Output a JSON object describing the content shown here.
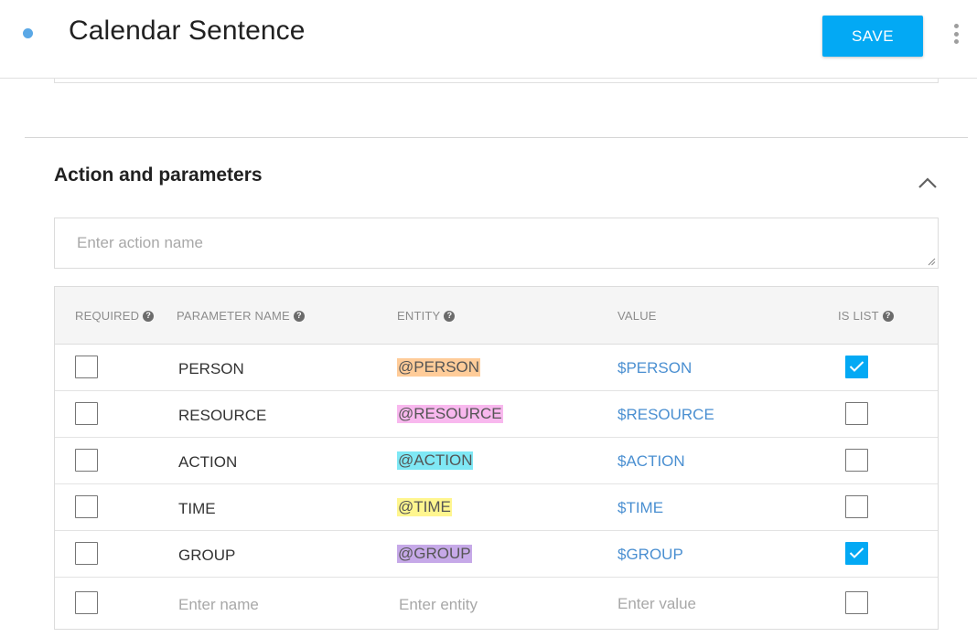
{
  "header": {
    "title": "Calendar Sentence",
    "save_label": "SAVE"
  },
  "section": {
    "title": "Action and parameters",
    "action_placeholder": "Enter action name"
  },
  "table": {
    "columns": {
      "required": "REQUIRED",
      "parameter_name": "PARAMETER NAME",
      "entity": "ENTITY",
      "value": "VALUE",
      "is_list": "IS LIST"
    },
    "rows": [
      {
        "required": false,
        "name": "PERSON",
        "entity": "@PERSON",
        "entity_color": "#ffcc99",
        "value": "$PERSON",
        "is_list": true
      },
      {
        "required": false,
        "name": "RESOURCE",
        "entity": "@RESOURCE",
        "entity_color": "#f8b8ee",
        "value": "$RESOURCE",
        "is_list": false
      },
      {
        "required": false,
        "name": "ACTION",
        "entity": "@ACTION",
        "entity_color": "#7fe8f5",
        "value": "$ACTION",
        "is_list": false
      },
      {
        "required": false,
        "name": "TIME",
        "entity": "@TIME",
        "entity_color": "#fff68f",
        "value": "$TIME",
        "is_list": false
      },
      {
        "required": false,
        "name": "GROUP",
        "entity": "@GROUP",
        "entity_color": "#c6a9e8",
        "value": "$GROUP",
        "is_list": true
      }
    ],
    "new_row": {
      "name_placeholder": "Enter name",
      "entity_placeholder": "Enter entity",
      "value_placeholder": "Enter value"
    }
  },
  "colors": {
    "accent": "#03a9f4",
    "value_link": "#4a8fd1",
    "status_dot": "#5aa8e6"
  },
  "icons": {
    "status": "dot-icon",
    "menu": "more-vert-icon",
    "collapse": "chevron-up-icon",
    "help": "help-circle-icon",
    "check": "check-icon"
  }
}
